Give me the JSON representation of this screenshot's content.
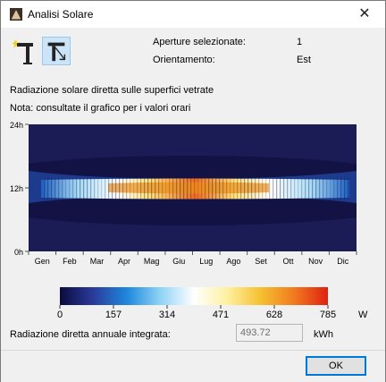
{
  "window": {
    "title": "Analisi Solare",
    "close_glyph": "✕"
  },
  "toolbar": {
    "tools": [
      {
        "icon": "sun-wall-icon",
        "selected": false
      },
      {
        "icon": "sun-projection-icon",
        "selected": true
      }
    ]
  },
  "info": [
    {
      "label": "Aperture selezionate:",
      "value": "1"
    },
    {
      "label": "Orientamento:",
      "value": "Est"
    }
  ],
  "headings": {
    "title": "Radiazione solare diretta sulle superfici vetrate",
    "note": "Nota: consultate il grafico per i valori orari"
  },
  "chart_data": {
    "type": "heatmap",
    "title": "Radiazione solare diretta sulle superfici vetrate",
    "x_categories": [
      "Gen",
      "Feb",
      "Mar",
      "Apr",
      "Mag",
      "Giu",
      "Lug",
      "Ago",
      "Set",
      "Ott",
      "Nov",
      "Dic"
    ],
    "y_ticks": [
      "0h",
      "12h",
      "24h"
    ],
    "y_range": [
      0,
      24
    ],
    "color_scale": {
      "min": 0,
      "max": 785,
      "unit": "W"
    }
  },
  "legend": {
    "ticks": [
      "0",
      "157",
      "314",
      "471",
      "628",
      "785"
    ],
    "unit": "W",
    "colors": [
      "#0b0b3d",
      "#2a3b9c",
      "#1e88dc",
      "#8fd3f5",
      "#ffffff",
      "#fff0a0",
      "#f5c030",
      "#f07a20",
      "#e02010"
    ]
  },
  "result": {
    "label": "Radiazione diretta annuale integrata:",
    "value": "493.72",
    "unit": "kWh"
  },
  "buttons": {
    "ok": "OK"
  }
}
